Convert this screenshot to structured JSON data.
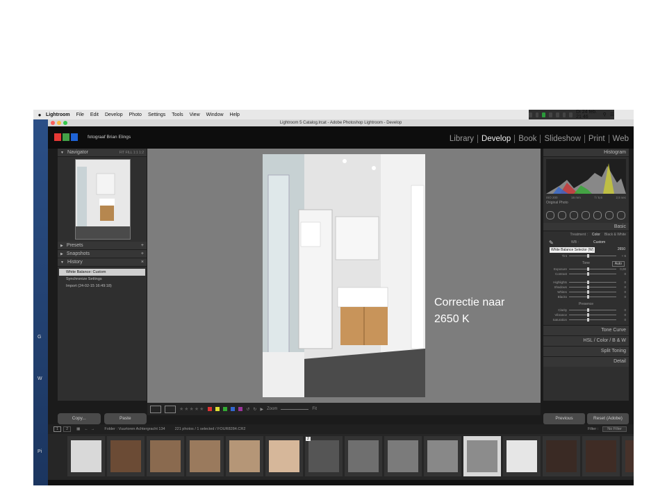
{
  "menubar": {
    "apple": "",
    "items": [
      "Lightroom",
      "File",
      "Edit",
      "Develop",
      "Photo",
      "Settings",
      "Tools",
      "View",
      "Window",
      "Help"
    ],
    "clock": "Di 24 feb.  21 46"
  },
  "window": {
    "title": "Lightroom 5 Catalog.lrcat - Adobe Photoshop Lightroom - Develop"
  },
  "identity_plate": "fotograaf Brian Elings",
  "modules": [
    {
      "label": "Library"
    },
    {
      "label": "Develop",
      "active": true
    },
    {
      "label": "Book"
    },
    {
      "label": "Slideshow"
    },
    {
      "label": "Print"
    },
    {
      "label": "Web"
    }
  ],
  "left_panel": {
    "navigator": "Navigator",
    "nav_tools": "FIT  FILL  1:1  1:2",
    "presets": "Presets",
    "snapshots": "Snapshots",
    "history": "History",
    "history_items": [
      "White Balance: Custom",
      "Synchronize Settings",
      "Import (24-02-15 16:49:18)"
    ],
    "copy": "Copy...",
    "paste": "Paste"
  },
  "center": {
    "annotation_line1": "Correctie naar",
    "annotation_line2": " 2650 K",
    "zoom_label": "Zoom",
    "fit_label": "Fit"
  },
  "right_panel": {
    "histogram": "Histogram",
    "hist_meta": [
      "ISO 200",
      "16 mm",
      "f / 5,6",
      "2,5 sec"
    ],
    "original_photo": "Original Photo",
    "basic": "Basic",
    "treatment": "Treatment :",
    "color": "Color",
    "bw": "Black & White",
    "wb": "WB :",
    "wb_value": "Custom",
    "wb_tooltip": "White Balance Selector (W)",
    "temp_value": "2650",
    "tint_label": "Tint",
    "tint_value": "+ 6",
    "tone": "Tone",
    "auto": "Auto",
    "tone_rows": [
      {
        "label": "Exposure",
        "value": "0,00"
      },
      {
        "label": "Contrast",
        "value": "0"
      },
      {
        "label": "Highlights",
        "value": "0"
      },
      {
        "label": "Shadows",
        "value": "0"
      },
      {
        "label": "Whites",
        "value": "0"
      },
      {
        "label": "Blacks",
        "value": "0"
      }
    ],
    "presence": "Presence",
    "presence_rows": [
      {
        "label": "Clarity",
        "value": "0"
      },
      {
        "label": "Vibrance",
        "value": "0"
      },
      {
        "label": "Saturation",
        "value": "0"
      }
    ],
    "tone_curve": "Tone Curve",
    "hsl": "HSL  /  Color  /  B & W",
    "split_toning": "Split Toning",
    "detail": "Detail",
    "previous": "Previous",
    "reset": "Reset (Adobe)"
  },
  "filmstrip": {
    "pages": [
      "1",
      "2"
    ],
    "folder": "Folder : Vuurtoren Achtergracht 134",
    "count": "221 photos / 1 selected / FOUR8284.CR2",
    "filter_label": "Filter :",
    "filter_value": "No Filter",
    "thumbs": [
      {
        "tone": "#d9d9d9"
      },
      {
        "tone": "#6b4b35"
      },
      {
        "tone": "#8a6a4f"
      },
      {
        "tone": "#9a7a5d"
      },
      {
        "tone": "#b59677"
      },
      {
        "tone": "#d6b79a"
      },
      {
        "tone": "#555555",
        "badge": "2"
      },
      {
        "tone": "#6f6f6f"
      },
      {
        "tone": "#7b7b7b"
      },
      {
        "tone": "#888888"
      },
      {
        "tone": "#8c8c8c",
        "selected": true
      },
      {
        "tone": "#e6e6e6"
      },
      {
        "tone": "#3a2a24"
      },
      {
        "tone": "#3f2c25"
      },
      {
        "tone": "#47322a"
      }
    ]
  },
  "colors": {
    "logo_red": "#e53935",
    "logo_green": "#43a047",
    "logo_blue": "#1e63d6",
    "desktop": "#1f3f6e"
  }
}
